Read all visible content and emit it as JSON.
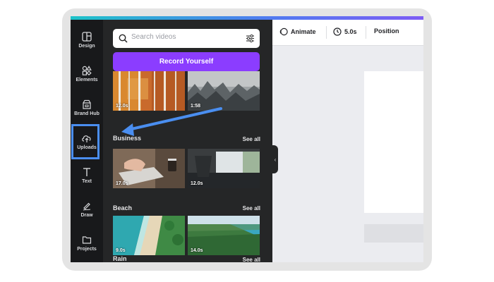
{
  "colors": {
    "rail_bg": "#18191b",
    "panel_bg": "#252627",
    "record_button": "#8b3dff",
    "highlight": "#4a8ef0",
    "canvas_bg": "#ebecf0"
  },
  "sidebar": {
    "items": [
      {
        "label": "Design",
        "icon": "design-icon"
      },
      {
        "label": "Elements",
        "icon": "elements-icon"
      },
      {
        "label": "Brand Hub",
        "icon": "brand-hub-icon"
      },
      {
        "label": "Uploads",
        "icon": "upload-cloud-icon",
        "highlighted": true
      },
      {
        "label": "Text",
        "icon": "text-icon"
      },
      {
        "label": "Draw",
        "icon": "draw-icon"
      },
      {
        "label": "Projects",
        "icon": "folder-icon"
      }
    ]
  },
  "panel": {
    "search": {
      "placeholder": "Search videos",
      "value": ""
    },
    "record_button": "Record Yourself",
    "top_videos": [
      {
        "duration": "12.0s",
        "scene": "autumn-forest"
      },
      {
        "duration": "1:58",
        "scene": "misty-forest"
      }
    ],
    "sections": [
      {
        "title": "Business",
        "see_all": "See all",
        "videos": [
          {
            "duration": "17.0s",
            "scene": "typing-keyboard"
          },
          {
            "duration": "12.0s",
            "scene": "office-interior"
          }
        ]
      },
      {
        "title": "Beach",
        "see_all": "See all",
        "videos": [
          {
            "duration": "9.0s",
            "scene": "aerial-beach"
          },
          {
            "duration": "14.0s",
            "scene": "tropical-coast"
          }
        ]
      },
      {
        "title": "Rain",
        "see_all": "See all",
        "videos": []
      }
    ]
  },
  "toolbar": {
    "animate": "Animate",
    "duration": "5.0s",
    "position": "Position"
  }
}
